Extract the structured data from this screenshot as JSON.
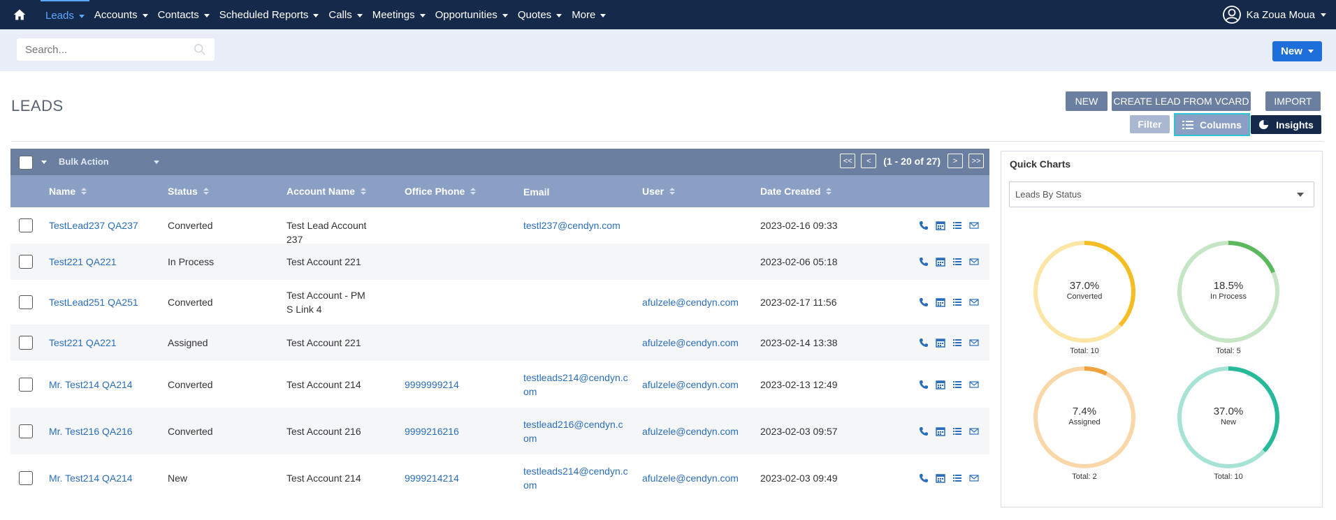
{
  "nav": {
    "items": [
      {
        "label": "Leads",
        "active": true
      },
      {
        "label": "Accounts"
      },
      {
        "label": "Contacts"
      },
      {
        "label": "Scheduled Reports"
      },
      {
        "label": "Calls"
      },
      {
        "label": "Meetings"
      },
      {
        "label": "Opportunities"
      },
      {
        "label": "Quotes"
      },
      {
        "label": "More"
      }
    ],
    "user_name": "Ka Zoua Moua"
  },
  "search": {
    "placeholder": "Search..."
  },
  "header": {
    "new_label": "New",
    "page_title": "LEADS"
  },
  "actions": {
    "new": "NEW",
    "vcard": "CREATE LEAD FROM VCARD",
    "import": "IMPORT",
    "filter": "Filter",
    "columns": "Columns",
    "insights": "Insights"
  },
  "table": {
    "bulk_action": "Bulk Action",
    "pager": {
      "first": "<<",
      "prev": "<",
      "range": "(1 - 20 of 27)",
      "next": ">",
      "last": ">>"
    },
    "columns": [
      "Name",
      "Status",
      "Account Name",
      "Office Phone",
      "Email",
      "User",
      "Date Created"
    ],
    "rows": [
      {
        "name": "TestLead237 QA237",
        "status": "Converted",
        "account": "Test Lead Account 237",
        "phone": "",
        "email": "testl237@cendyn.com",
        "user": "",
        "date": "2023-02-16 09:33"
      },
      {
        "name": "Test221 QA221",
        "status": "In Process",
        "account": "Test Account 221",
        "phone": "",
        "email": "",
        "user": "",
        "date": "2023-02-06 05:18"
      },
      {
        "name": "TestLead251 QA251",
        "status": "Converted",
        "account": "Test Account - PMS Link 4",
        "phone": "",
        "email": "",
        "user": "afulzele@cendyn.com",
        "date": "2023-02-17 11:56"
      },
      {
        "name": "Test221 QA221",
        "status": "Assigned",
        "account": "Test Account 221",
        "phone": "",
        "email": "",
        "user": "afulzele@cendyn.com",
        "date": "2023-02-14 13:38"
      },
      {
        "name": "Mr. Test214 QA214",
        "status": "Converted",
        "account": "Test Account 214",
        "phone": "9999999214",
        "email": "testleads214@cendyn.com",
        "user": "afulzele@cendyn.com",
        "date": "2023-02-13 12:49"
      },
      {
        "name": "Mr. Test216 QA216",
        "status": "Converted",
        "account": "Test Account 216",
        "phone": "9999216216",
        "email": "testlead216@cendyn.com",
        "user": "afulzele@cendyn.com",
        "date": "2023-02-03 09:57"
      },
      {
        "name": "Mr. Test214 QA214",
        "status": "New",
        "account": "Test Account 214",
        "phone": "9999214214",
        "email": "testleads214@cendyn.com",
        "user": "afulzele@cendyn.com",
        "date": "2023-02-03 09:49"
      }
    ]
  },
  "quick_charts": {
    "title": "Quick Charts",
    "selected": "Leads By Status",
    "donuts": [
      {
        "pct": "37.0%",
        "label": "Converted",
        "total": "Total: 10",
        "fraction": 0.37,
        "color": "#f5bd24",
        "track": "#fce6a6"
      },
      {
        "pct": "18.5%",
        "label": "In Process",
        "total": "Total: 5",
        "fraction": 0.185,
        "color": "#5cb85c",
        "track": "#c5e6c5"
      },
      {
        "pct": "7.4%",
        "label": "Assigned",
        "total": "Total: 2",
        "fraction": 0.074,
        "color": "#f0a23c",
        "track": "#fad7a8"
      },
      {
        "pct": "37.0%",
        "label": "New",
        "total": "Total: 10",
        "fraction": 0.37,
        "color": "#26b99a",
        "track": "#a6e3d4"
      }
    ]
  },
  "colors": {
    "nav_bg": "#15294b",
    "accent": "#1e6fd9",
    "link": "#2a6ebb",
    "header_bar": "#6b7fa0",
    "col_header": "#8a9fc4"
  }
}
